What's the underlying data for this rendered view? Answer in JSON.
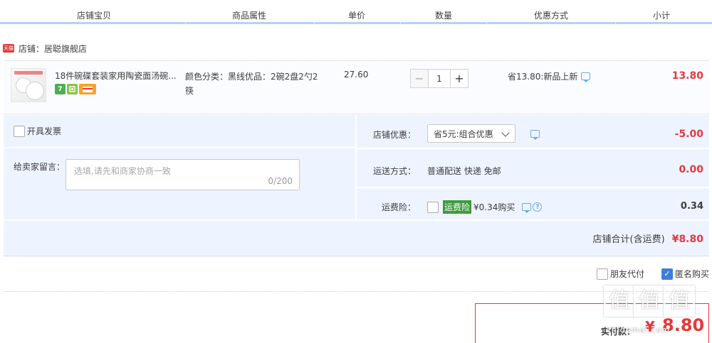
{
  "header": {
    "columns": [
      "店铺宝贝",
      "商品属性",
      "单价",
      "数量",
      "优惠方式",
      "小计"
    ]
  },
  "shop": {
    "badge": "天猫",
    "label": "店铺：居聪旗舰店"
  },
  "item": {
    "title": "18件碗碟套装家用陶瓷面汤碗...",
    "attribute": "颜色分类：黑线优品：2碗2盘2勺2筷",
    "price": "27.60",
    "quantity": "1",
    "qty_minus": "−",
    "qty_plus": "+",
    "discount": "省13.80:新品上新",
    "subtotal": "13.80",
    "service_icons": [
      "7",
      "tmall-service-icon",
      "card-icon"
    ]
  },
  "options": {
    "invoice_label": "开具发票",
    "message_label": "给卖家留言：",
    "message_placeholder": "选填,请先和商家协商一致",
    "message_count": "0/200",
    "shop_discount_label": "店铺优惠：",
    "shop_discount_value": "省5元:组合优惠",
    "shop_discount_amount": "-5.00",
    "shipping_label": "运送方式：",
    "shipping_value": "普通配送 快递 免邮",
    "shipping_amount": "0.00",
    "insurance_label": "运费险：",
    "insurance_badge": "运费险",
    "insurance_text": "¥0.34购买",
    "insurance_amount": "0.34",
    "shop_total_label": "店铺合计(含运费)",
    "shop_total_amount": "¥8.80"
  },
  "extras": {
    "friend_pay": "朋友代付",
    "anonymous": "匿名购买"
  },
  "payment": {
    "label": "实付款：",
    "currency": "¥",
    "amount": "8.80"
  },
  "watermark": {
    "sub": "zhidemai.com"
  },
  "colors": {
    "accent_red": "#e4393c",
    "header_line": "#b2d1ff",
    "panel_bg": "#eef4ff",
    "insurance_green": "#3e9b3e",
    "checkbox_blue": "#3f7ddb"
  }
}
